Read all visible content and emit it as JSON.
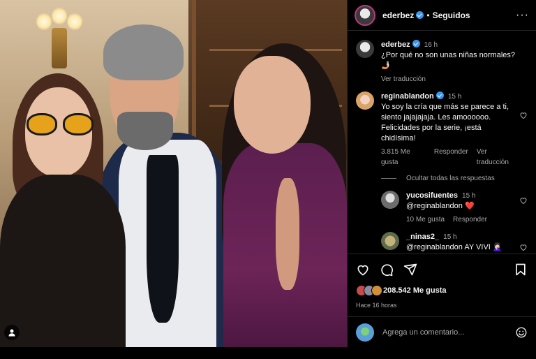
{
  "post": {
    "author": "ederbez",
    "separator": "•",
    "follow_status": "Seguidos",
    "more": "···"
  },
  "caption": {
    "user": "ederbez",
    "time": "16 h",
    "text": "¿Por qué no son unas niñas normales? 🤳🏻",
    "translate": "Ver traducción"
  },
  "comments": [
    {
      "user": "reginablandon",
      "time": "15 h",
      "text": "Yo soy la cría que más se parece a ti, siento jajajajaja. Les amoooooo. Felicidades por la serie, ¡está chidísima!",
      "likes": "3.815 Me gusta",
      "reply": "Responder",
      "translate": "Ver traducción"
    }
  ],
  "hide_replies": "Ocultar todas las respuestas",
  "replies": [
    {
      "user": "yucosifuentes",
      "time": "15 h",
      "text": "@reginablandon ❤️",
      "likes": "10 Me gusta",
      "reply": "Responder"
    },
    {
      "user": "_ninas2_",
      "time": "15 h",
      "text": "@reginablandon AY VIVI 🤦🏻‍♀️"
    }
  ],
  "likes_count": "208.542 Me gusta",
  "time_ago": "Hace 16 horas",
  "composer": {
    "placeholder": "Agrega un comentario..."
  },
  "colors": {
    "accent": "#3897f0",
    "like": "#ff3040",
    "muted": "#a8a8a8"
  }
}
